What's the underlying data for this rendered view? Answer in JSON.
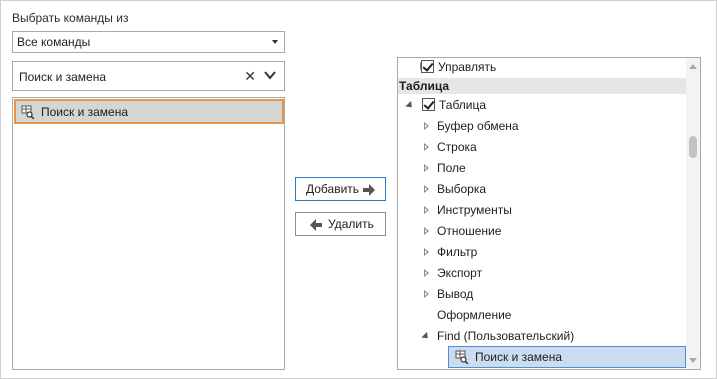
{
  "left": {
    "choose_label": "Выбрать команды из",
    "combo_value": "Все команды",
    "search_value": "Поиск и замена",
    "list_items": [
      "Поиск и замена"
    ]
  },
  "buttons": {
    "add_label": "Добавить",
    "remove_label": "Удалить"
  },
  "tree": {
    "top_partial": "Управлять",
    "group_header": "Таблица",
    "root": "Таблица",
    "children": [
      "Буфер обмена",
      "Строка",
      "Поле",
      "Выборка",
      "Инструменты",
      "Отношение",
      "Фильтр",
      "Экспорт",
      "Вывод"
    ],
    "leaf": "Оформление",
    "custom_group": "Find (Пользовательский)",
    "selected_item": "Поиск и замена"
  },
  "colors": {
    "accent_border": "#e8944a",
    "selection_fill": "#c9dcf0",
    "selection_border": "#4f8fcf",
    "primary_button_border": "#2c7cc4"
  }
}
